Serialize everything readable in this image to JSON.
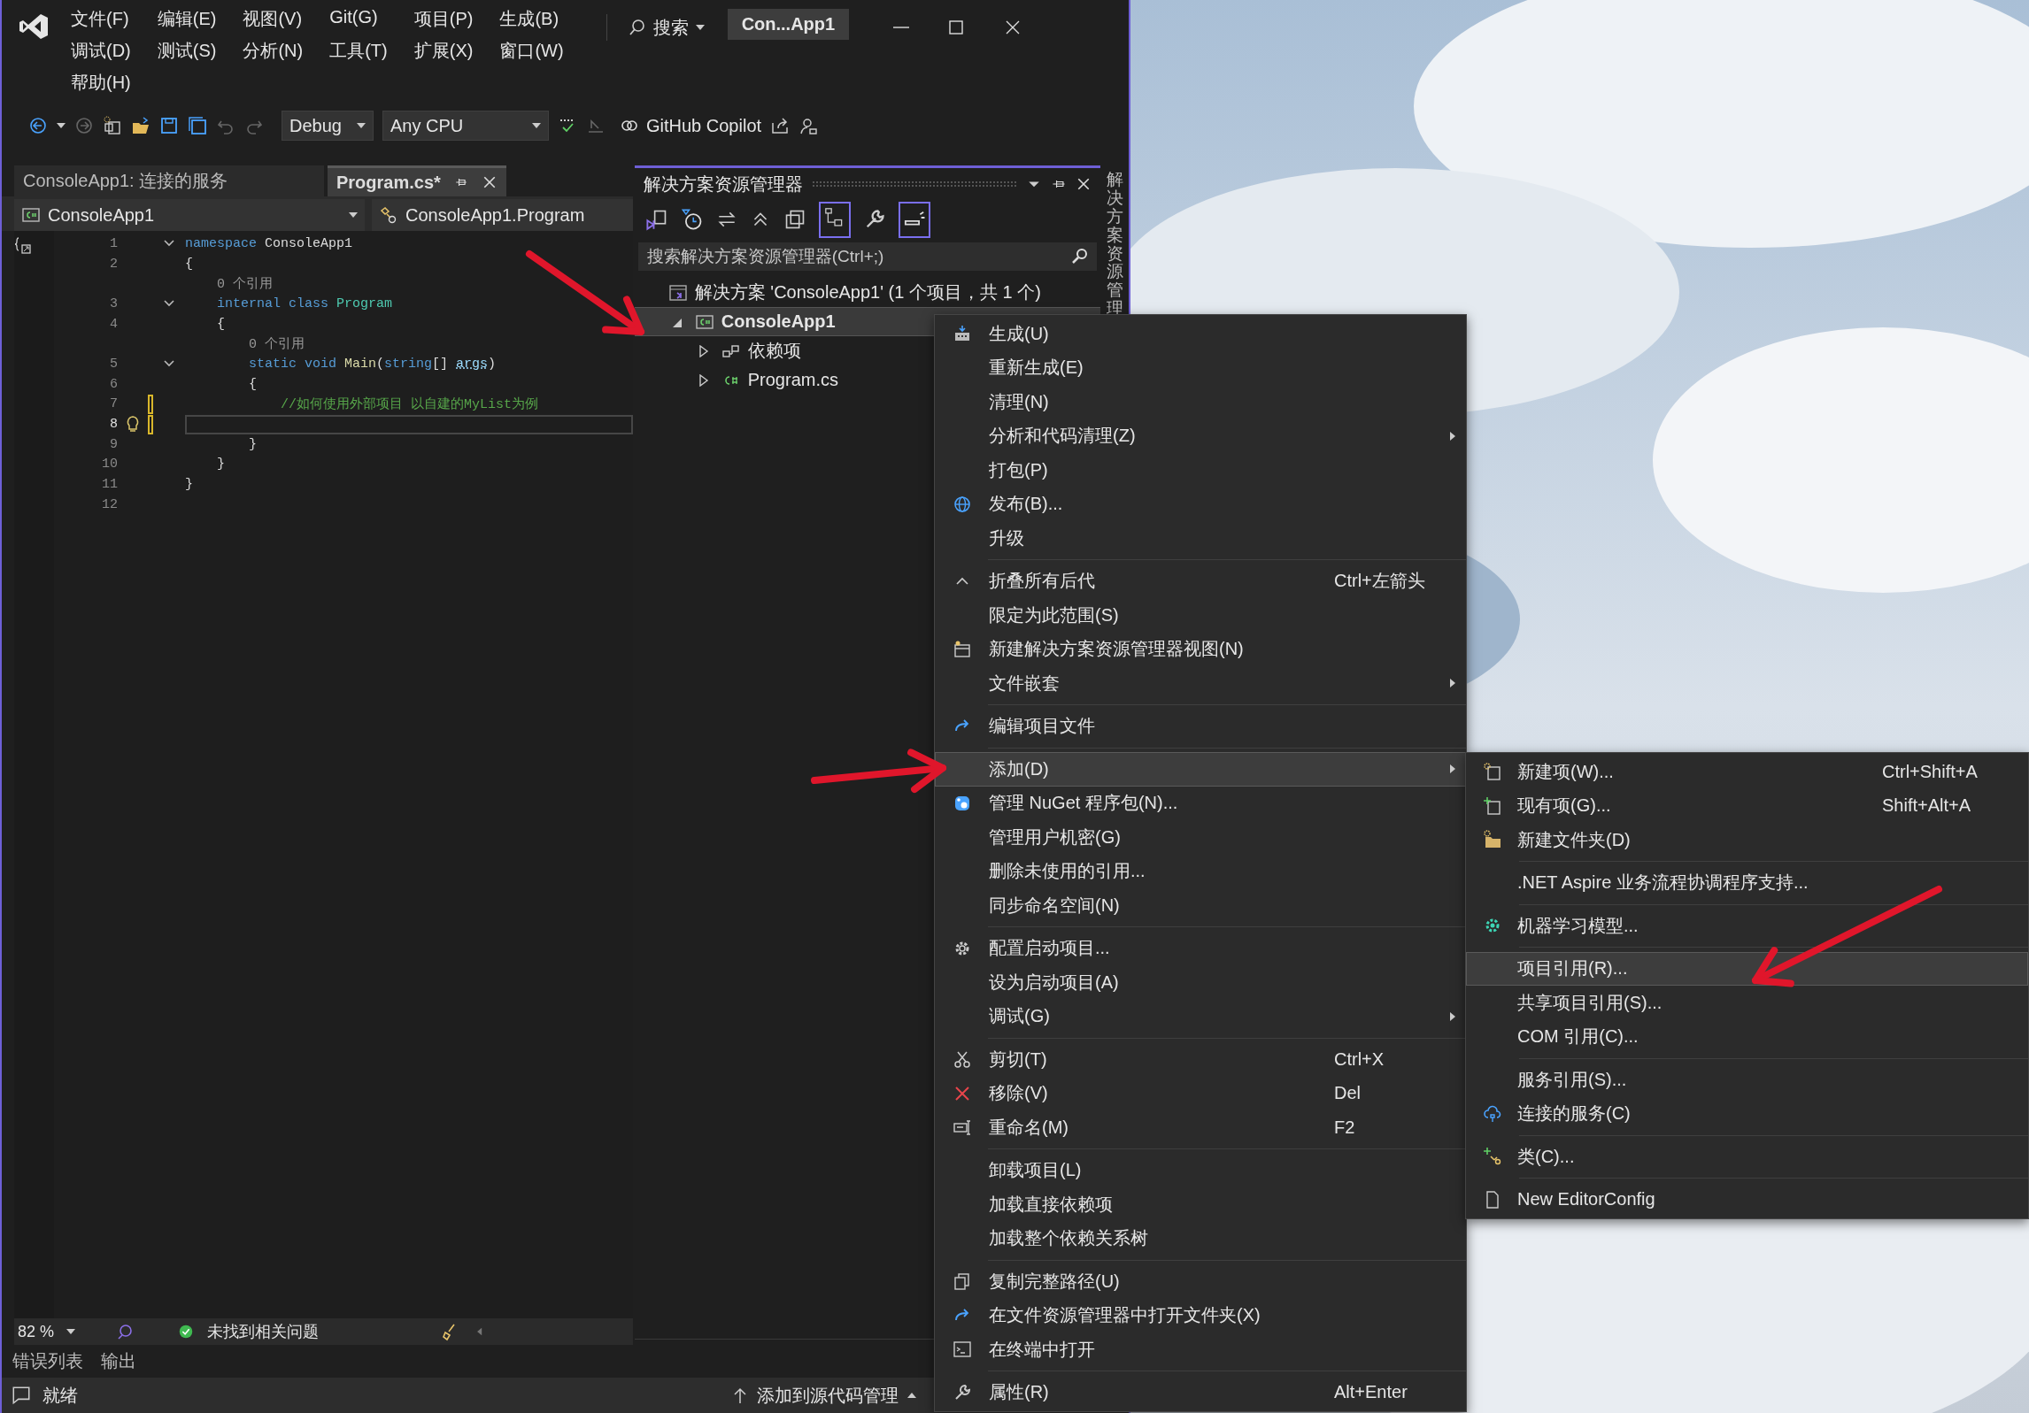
{
  "menu_bar": {
    "items": [
      "文件(F)",
      "编辑(E)",
      "视图(V)",
      "Git(G)",
      "项目(P)",
      "生成(B)",
      "调试(D)",
      "测试(S)",
      "分析(N)",
      "工具(T)",
      "扩展(X)",
      "窗口(W)",
      "帮助(H)"
    ]
  },
  "search": {
    "label": "搜索"
  },
  "window_title": "Con...App1",
  "toolbar": {
    "configuration": "Debug",
    "platform": "Any CPU",
    "copilot": "GitHub Copilot"
  },
  "document_tabs": [
    {
      "label": "ConsoleApp1: 连接的服务",
      "selected": false
    },
    {
      "label": "Program.cs*",
      "selected": true
    }
  ],
  "navigation": {
    "project": "ConsoleApp1",
    "type": "ConsoleApp1.Program"
  },
  "code_lines": [
    {
      "kind": "code",
      "number": "1",
      "fold": true,
      "current": false,
      "modified": false,
      "tokens": [
        {
          "kind": "keyword",
          "text": "namespace"
        },
        {
          "kind": "plain",
          "text": " ConsoleApp1"
        }
      ]
    },
    {
      "kind": "code",
      "number": "2",
      "fold": false,
      "current": false,
      "modified": false,
      "tokens": [
        {
          "kind": "plain",
          "text": "{"
        }
      ]
    },
    {
      "kind": "codelens",
      "text": "    0 个引用"
    },
    {
      "kind": "code",
      "number": "3",
      "fold": true,
      "current": false,
      "modified": false,
      "tokens": [
        {
          "kind": "keyword",
          "text": "    internal class"
        },
        {
          "kind": "type",
          "text": " Program"
        }
      ]
    },
    {
      "kind": "code",
      "number": "4",
      "fold": false,
      "current": false,
      "modified": false,
      "tokens": [
        {
          "kind": "plain",
          "text": "    {"
        }
      ]
    },
    {
      "kind": "codelens",
      "text": "        0 个引用"
    },
    {
      "kind": "code",
      "number": "5",
      "fold": true,
      "current": false,
      "modified": false,
      "tokens": [
        {
          "kind": "keyword",
          "text": "        static void"
        },
        {
          "kind": "method",
          "text": " Main"
        },
        {
          "kind": "plain",
          "text": "("
        },
        {
          "kind": "keyword",
          "text": "string"
        },
        {
          "kind": "plain",
          "text": "[] "
        },
        {
          "kind": "parameter",
          "text": "args"
        },
        {
          "kind": "plain",
          "text": ")"
        }
      ]
    },
    {
      "kind": "code",
      "number": "6",
      "fold": false,
      "current": false,
      "modified": false,
      "tokens": [
        {
          "kind": "plain",
          "text": "        {"
        }
      ]
    },
    {
      "kind": "code",
      "number": "7",
      "fold": false,
      "current": false,
      "modified": true,
      "tokens": [
        {
          "kind": "comment",
          "text": "            //如何使用外部项目 以自建的MyList为例"
        }
      ]
    },
    {
      "kind": "code",
      "number": "8",
      "fold": false,
      "current": true,
      "modified": true
    },
    {
      "kind": "code",
      "number": "9",
      "fold": false,
      "current": false,
      "modified": false,
      "tokens": [
        {
          "kind": "plain",
          "text": "        }"
        }
      ]
    },
    {
      "kind": "code",
      "number": "10",
      "fold": false,
      "current": false,
      "modified": false,
      "tokens": [
        {
          "kind": "plain",
          "text": "    }"
        }
      ]
    },
    {
      "kind": "code",
      "number": "11",
      "fold": false,
      "current": false,
      "modified": false,
      "tokens": [
        {
          "kind": "plain",
          "text": "}"
        }
      ]
    },
    {
      "kind": "code",
      "number": "12",
      "fold": false,
      "current": false,
      "modified": false
    }
  ],
  "editor_status": {
    "zoom": "82 %",
    "issues": "未找到相关问题"
  },
  "solution_explorer": {
    "title": "解决方案资源管理器",
    "search_placeholder": "搜索解决方案资源管理器(Ctrl+;)",
    "tree": [
      {
        "kind": "solution",
        "label": "解决方案 'ConsoleApp1' (1 个项目，共 1 个)",
        "selected": false,
        "children": [
          {
            "kind": "project",
            "label": "ConsoleApp1",
            "selected": true,
            "expanded": true,
            "children": [
              {
                "kind": "dependencies",
                "label": "依赖项",
                "selected": false,
                "expanded": false
              },
              {
                "kind": "csharp",
                "label": "Program.cs",
                "selected": false,
                "expanded": false
              }
            ]
          }
        ]
      }
    ],
    "side_tab": "解决方案资源管理"
  },
  "context_menu": {
    "items": [
      {
        "kind": "item",
        "label": "生成(U)",
        "submenu": false,
        "selected": false
      },
      {
        "kind": "item",
        "label": "重新生成(E)",
        "submenu": false,
        "selected": false
      },
      {
        "kind": "item",
        "label": "清理(N)",
        "submenu": false,
        "selected": false
      },
      {
        "kind": "item",
        "label": "分析和代码清理(Z)",
        "submenu": true,
        "selected": false
      },
      {
        "kind": "item",
        "label": "打包(P)",
        "submenu": false,
        "selected": false
      },
      {
        "kind": "item",
        "label": "发布(B)...",
        "submenu": false,
        "selected": false
      },
      {
        "kind": "item",
        "label": "升级",
        "submenu": false,
        "selected": false
      },
      {
        "kind": "separator"
      },
      {
        "kind": "item",
        "label": "折叠所有后代",
        "shortcut": "Ctrl+左箭头",
        "submenu": false,
        "selected": false
      },
      {
        "kind": "item",
        "label": "限定为此范围(S)",
        "submenu": false,
        "selected": false
      },
      {
        "kind": "item",
        "label": "新建解决方案资源管理器视图(N)",
        "submenu": false,
        "selected": false
      },
      {
        "kind": "item",
        "label": "文件嵌套",
        "submenu": true,
        "selected": false
      },
      {
        "kind": "separator"
      },
      {
        "kind": "item",
        "label": "编辑项目文件",
        "submenu": false,
        "selected": false
      },
      {
        "kind": "separator"
      },
      {
        "kind": "item",
        "label": "添加(D)",
        "submenu": true,
        "selected": true
      },
      {
        "kind": "item",
        "label": "管理 NuGet 程序包(N)...",
        "submenu": false,
        "selected": false
      },
      {
        "kind": "item",
        "label": "管理用户机密(G)",
        "submenu": false,
        "selected": false
      },
      {
        "kind": "item",
        "label": "删除未使用的引用...",
        "submenu": false,
        "selected": false
      },
      {
        "kind": "item",
        "label": "同步命名空间(N)",
        "submenu": false,
        "selected": false
      },
      {
        "kind": "separator"
      },
      {
        "kind": "item",
        "label": "配置启动项目...",
        "submenu": false,
        "selected": false
      },
      {
        "kind": "item",
        "label": "设为启动项目(A)",
        "submenu": false,
        "selected": false
      },
      {
        "kind": "item",
        "label": "调试(G)",
        "submenu": true,
        "selected": false
      },
      {
        "kind": "separator"
      },
      {
        "kind": "item",
        "label": "剪切(T)",
        "shortcut": "Ctrl+X",
        "submenu": false,
        "selected": false
      },
      {
        "kind": "item",
        "label": "移除(V)",
        "shortcut": "Del",
        "submenu": false,
        "selected": false
      },
      {
        "kind": "item",
        "label": "重命名(M)",
        "shortcut": "F2",
        "submenu": false,
        "selected": false
      },
      {
        "kind": "separator"
      },
      {
        "kind": "item",
        "label": "卸载项目(L)",
        "submenu": false,
        "selected": false
      },
      {
        "kind": "item",
        "label": "加载直接依赖项",
        "submenu": false,
        "selected": false
      },
      {
        "kind": "item",
        "label": "加载整个依赖关系树",
        "submenu": false,
        "selected": false
      },
      {
        "kind": "separator"
      },
      {
        "kind": "item",
        "label": "复制完整路径(U)",
        "submenu": false,
        "selected": false
      },
      {
        "kind": "item",
        "label": "在文件资源管理器中打开文件夹(X)",
        "submenu": false,
        "selected": false
      },
      {
        "kind": "item",
        "label": "在终端中打开",
        "submenu": false,
        "selected": false
      },
      {
        "kind": "separator"
      },
      {
        "kind": "item",
        "label": "属性(R)",
        "shortcut": "Alt+Enter",
        "submenu": false,
        "selected": false
      }
    ]
  },
  "add_submenu": {
    "items": [
      {
        "kind": "item",
        "label": "新建项(W)...",
        "shortcut": "Ctrl+Shift+A",
        "submenu": false,
        "selected": false
      },
      {
        "kind": "item",
        "label": "现有项(G)...",
        "shortcut": "Shift+Alt+A",
        "submenu": false,
        "selected": false
      },
      {
        "kind": "item",
        "label": "新建文件夹(D)",
        "submenu": false,
        "selected": false
      },
      {
        "kind": "separator"
      },
      {
        "kind": "item",
        "label": ".NET Aspire 业务流程协调程序支持...",
        "submenu": false,
        "selected": false
      },
      {
        "kind": "separator"
      },
      {
        "kind": "item",
        "label": "机器学习模型...",
        "submenu": false,
        "selected": false
      },
      {
        "kind": "separator"
      },
      {
        "kind": "item",
        "label": "项目引用(R)...",
        "submenu": false,
        "selected": true
      },
      {
        "kind": "item",
        "label": "共享项目引用(S)...",
        "submenu": false,
        "selected": false
      },
      {
        "kind": "item",
        "label": "COM 引用(C)...",
        "submenu": false,
        "selected": false
      },
      {
        "kind": "separator"
      },
      {
        "kind": "item",
        "label": "服务引用(S)...",
        "submenu": false,
        "selected": false
      },
      {
        "kind": "item",
        "label": "连接的服务(C)",
        "submenu": false,
        "selected": false
      },
      {
        "kind": "separator"
      },
      {
        "kind": "item",
        "label": "类(C)...",
        "submenu": false,
        "selected": false
      },
      {
        "kind": "separator"
      },
      {
        "kind": "item",
        "label": "New EditorConfig",
        "submenu": false,
        "selected": false
      }
    ]
  },
  "bottom_tabs": [
    "错误列表",
    "输出"
  ],
  "status_bar": {
    "state": "就绪",
    "source_control": "添加到源代码管理"
  }
}
